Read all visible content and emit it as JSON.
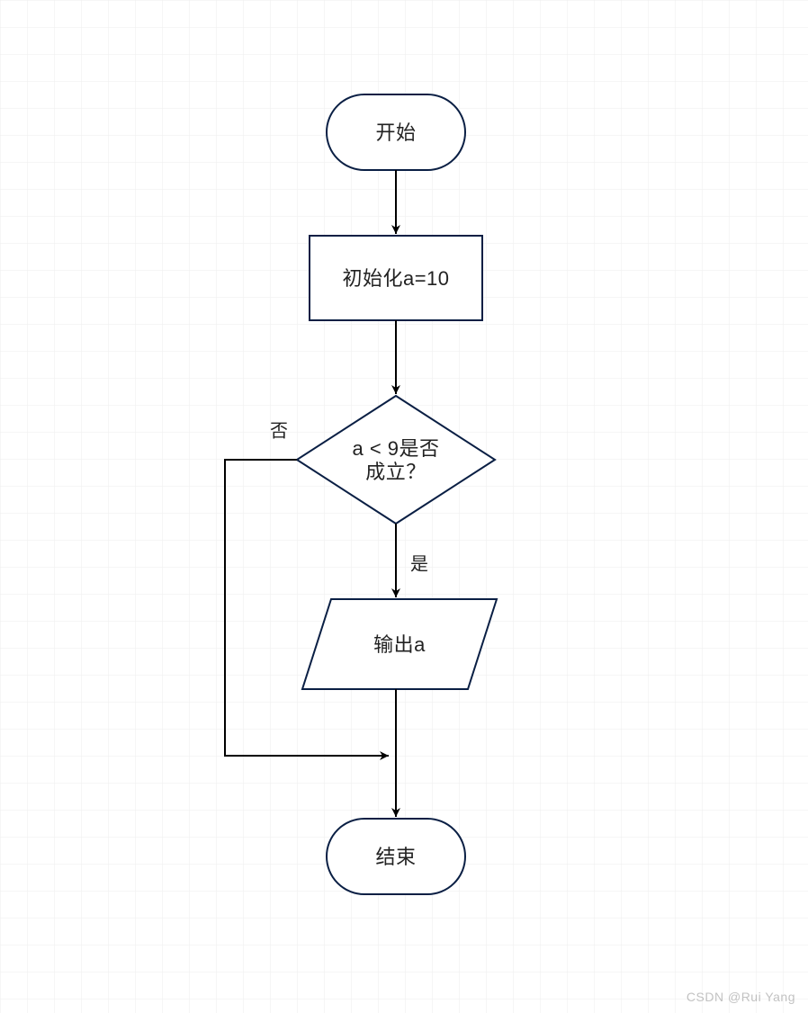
{
  "diagram": {
    "grid": {
      "cell": 30,
      "minorColor": "#e9e9e9",
      "majorColor": "#e0e0e0"
    },
    "shapeStroke": "#0a1f44",
    "shapeFill": "#ffffff",
    "arrowColor": "#000000",
    "nodes": {
      "start": {
        "label": "开始"
      },
      "init": {
        "label": "初始化a=10"
      },
      "cond": {
        "line1": "a < 9是否",
        "line2": "成立？"
      },
      "output": {
        "label": "输出a"
      },
      "end": {
        "label": "结束"
      }
    },
    "edgeLabels": {
      "no": "否",
      "yes": "是"
    }
  },
  "watermark": "CSDN @Rui Yang"
}
